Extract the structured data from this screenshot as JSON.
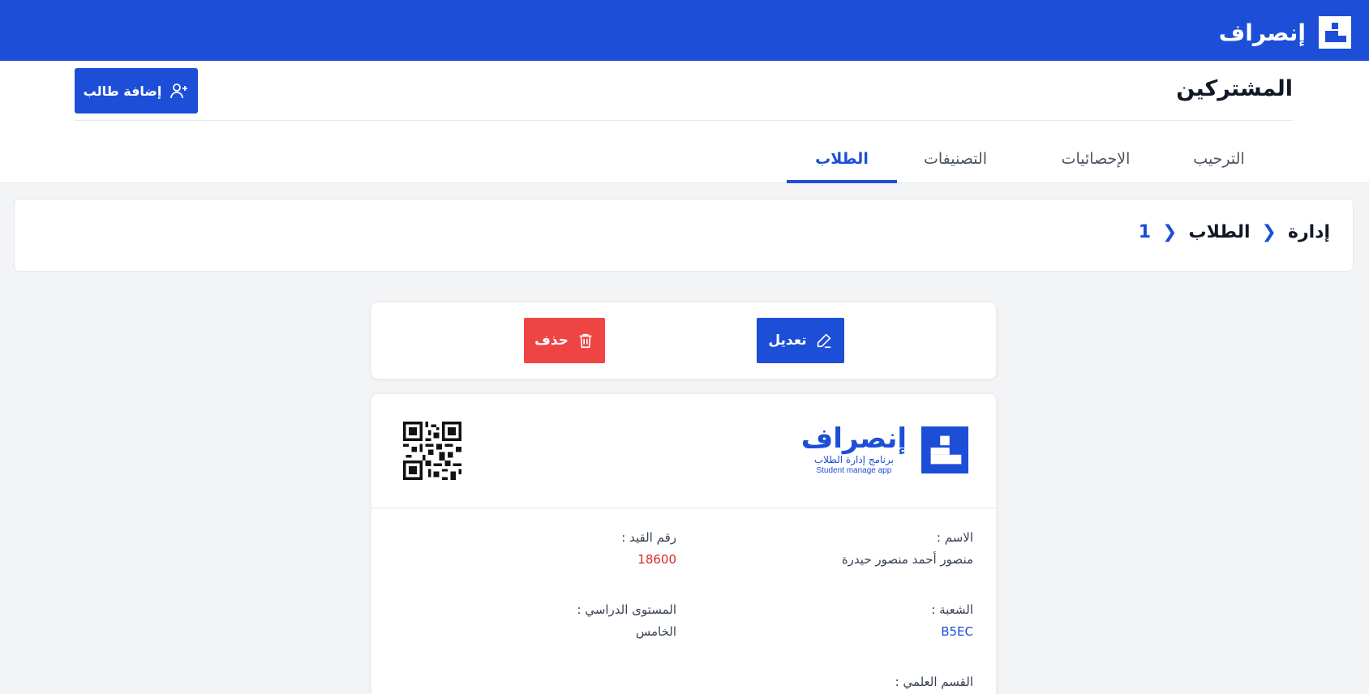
{
  "app": {
    "name": "إنصراف",
    "subtitle": "برنامج إدارة الطلاب",
    "subtitle_en": "Student manage app"
  },
  "header": {
    "title": "المشتركين",
    "add_button_label": "إضافة طالب"
  },
  "tabs": [
    {
      "label": "الترحيب",
      "active": false
    },
    {
      "label": "الإحصائيات",
      "active": false
    },
    {
      "label": "التصنيفات",
      "active": false
    },
    {
      "label": "الطلاب",
      "active": true
    }
  ],
  "breadcrumb": [
    "إدارة",
    "الطلاب",
    "1"
  ],
  "actions": {
    "edit_label": "تعديل",
    "delete_label": "حذف"
  },
  "student": {
    "name_label": "الاسم :",
    "name_value": "منصور أحمد منصور حيدرة",
    "id_label": "رقم القيد :",
    "id_value": "18600",
    "section_label": "الشعبة :",
    "section_value": "B5EC",
    "level_label": "المستوى الدراسي :",
    "level_value": "الخامس",
    "department_label": "القسم العلمي :"
  },
  "colors": {
    "primary": "#1d4ed8",
    "danger": "#ef4444",
    "background": "#f3f4f6"
  }
}
